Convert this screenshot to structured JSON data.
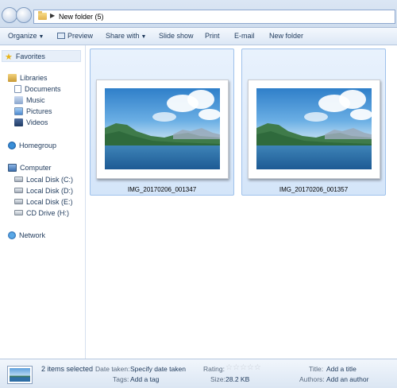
{
  "address": {
    "path_label": "New folder (5)"
  },
  "toolbar": {
    "organize": "Organize",
    "preview": "Preview",
    "share_with": "Share with",
    "slide_show": "Slide show",
    "print": "Print",
    "email": "E-mail",
    "new_folder": "New folder"
  },
  "sidebar": {
    "favorites": "Favorites",
    "libraries": "Libraries",
    "documents": "Documents",
    "music": "Music",
    "pictures": "Pictures",
    "videos": "Videos",
    "homegroup": "Homegroup",
    "computer": "Computer",
    "disk_c": "Local Disk (C:)",
    "disk_d": "Local Disk (D:)",
    "disk_e": "Local Disk (E:)",
    "cd_drive": "CD Drive (H:)",
    "network": "Network"
  },
  "files": [
    {
      "name": "IMG_20170206_001347"
    },
    {
      "name": "IMG_20170206_001357"
    }
  ],
  "details": {
    "selection": "2 items selected",
    "date_taken_label": "Date taken:",
    "date_taken_value": "Specify date taken",
    "tags_label": "Tags:",
    "tags_value": "Add a tag",
    "rating_label": "Rating:",
    "rating_value": 0,
    "size_label": "Size:",
    "size_value": "28.2 KB",
    "title_label": "Title:",
    "title_value": "Add a title",
    "authors_label": "Authors:",
    "authors_value": "Add an author"
  }
}
